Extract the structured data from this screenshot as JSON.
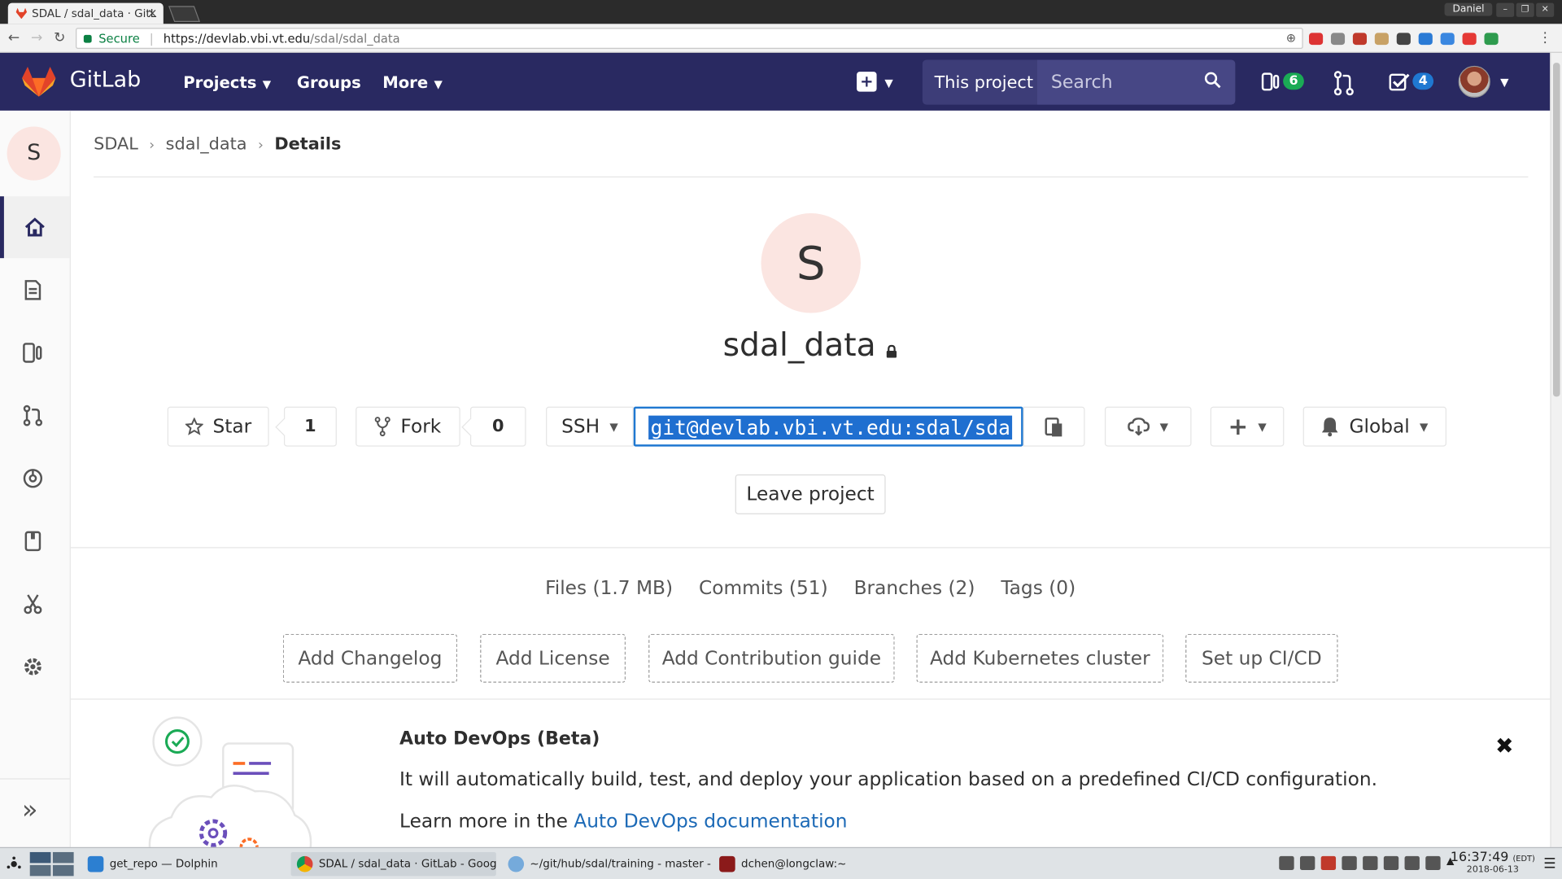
{
  "browser": {
    "tab_title": "SDAL / sdal_data · GitL",
    "tab_close": "×",
    "user": "Daniel",
    "url_secure": "Secure",
    "url_scheme_host": "https://devlab.vbi.vt.edu",
    "url_path": "/sdal/sdal_data"
  },
  "header": {
    "brand": "GitLab",
    "nav": {
      "projects": "Projects",
      "groups": "Groups",
      "more": "More"
    },
    "scope": "This project",
    "search_placeholder": "Search",
    "issues_count": "6",
    "todos_count": "4",
    "colors": {
      "header_bg": "#292961",
      "issues_badge": "#1aaa55",
      "todos_badge": "#1f78d1"
    }
  },
  "sidebar": {
    "project_initial": "S",
    "items": [
      {
        "icon": "home-icon"
      },
      {
        "icon": "repository-icon"
      },
      {
        "icon": "issues-icon"
      },
      {
        "icon": "merge-requests-icon"
      },
      {
        "icon": "ci-cd-icon"
      },
      {
        "icon": "wiki-icon"
      },
      {
        "icon": "snippets-icon"
      },
      {
        "icon": "settings-icon"
      }
    ],
    "collapse_icon": "double-chevron-right-icon"
  },
  "breadcrumb": {
    "group": "SDAL",
    "project": "sdal_data",
    "current": "Details"
  },
  "project": {
    "initial": "S",
    "name": "sdal_data",
    "star_label": "Star",
    "star_count": "1",
    "fork_label": "Fork",
    "fork_count": "0",
    "clone_protocol": "SSH",
    "clone_url": "git@devlab.vbi.vt.edu:sdal/sda",
    "notification_level": "Global",
    "leave_label": "Leave project"
  },
  "stats": {
    "files": "Files (1.7 MB)",
    "commits": "Commits (51)",
    "branches": "Branches (2)",
    "tags": "Tags (0)"
  },
  "quick_actions": {
    "changelog": "Add Changelog",
    "license": "Add License",
    "contribution": "Add Contribution guide",
    "kubernetes": "Add Kubernetes cluster",
    "cicd": "Set up CI/CD"
  },
  "auto_devops": {
    "title": "Auto DevOps (Beta)",
    "text": "It will automatically build, test, and deploy your application based on a predefined CI/CD configuration.",
    "learn_prefix": "Learn more in the ",
    "learn_link": "Auto DevOps documentation",
    "close": "✖"
  },
  "taskbar": {
    "tasks": [
      "get_repo — Dolphin",
      "SDAL / sdal_data · GitLab - Google ...",
      "~/git/hub/sdal/training - master - R...",
      "dchen@longclaw:~"
    ],
    "time": "16:37:49",
    "tz": "(EDT)",
    "date": "2018-06-13"
  }
}
